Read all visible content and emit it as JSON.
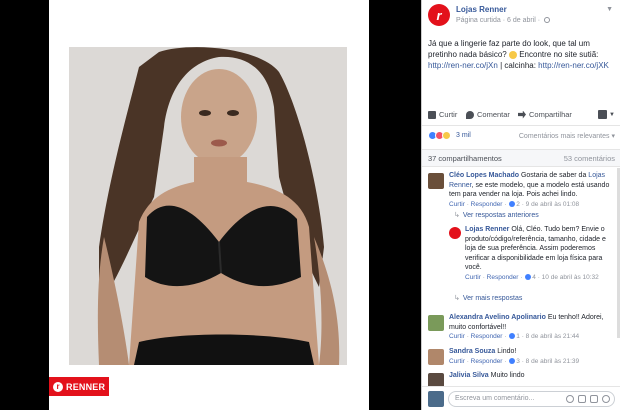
{
  "brand": {
    "logo_text": "RENNER",
    "logo_mark": "r",
    "red": "#e3111b"
  },
  "post": {
    "page_name": "Lojas Renner",
    "page_label": "Página curtida",
    "date": "6 de abril",
    "text_line": "Já que a lingerie faz parte do look, que tal um pretinho nada básico?",
    "text_cta": "Encontre no site sutiã:",
    "link1": "http://ren-ner.co/jXn",
    "separator": "| calcinha:",
    "link2": "http://ren-ner.co/jXK"
  },
  "actions": {
    "like": "Curtir",
    "comment": "Comentar",
    "share": "Compartilhar"
  },
  "reactions": {
    "count": "3 mil",
    "sort": "Comentários mais relevantes",
    "shares": "37 compartilhamentos",
    "comments": "53 comentários"
  },
  "comments": [
    {
      "author": "Cléo Lopes Machado",
      "text_before": "Gostaria de saber da",
      "mention": "Lojas Renner",
      "text_after": ", se este modelo, que a modelo está usando tem para vender na loja. Pois achei lindo.",
      "reply": "Responder",
      "like": "Curtir",
      "likes": "2",
      "time": "9 de abril às 01:08",
      "previous_replies": "Ver respostas anteriores"
    },
    {
      "author": "Lojas Renner",
      "text": "Olá, Cléo. Tudo bem? Envie o produto/código/referência, tamanho, cidade e loja de sua preferência. Assim poderemos verificar a disponibilidade em loja física para você.",
      "like": "Curtir",
      "reply": "Responder",
      "likes": "4",
      "time": "10 de abril às 10:32",
      "more_replies": "Ver mais respostas"
    },
    {
      "author": "Alexandra Avelino Apolinario",
      "text": "Eu tenho!! Adorei, muito confortável!!",
      "like": "Curtir",
      "reply": "Responder",
      "likes": "1",
      "time": "8 de abril às 21:44"
    },
    {
      "author": "Sandra Souza",
      "text": "Lindo!",
      "like": "Curtir",
      "reply": "Responder",
      "likes": "3",
      "time": "8 de abril às 21:39"
    },
    {
      "author": "Jalivia Silva",
      "text": "Muito lindo"
    }
  ],
  "composer": {
    "placeholder": "Escreva um comentário..."
  }
}
